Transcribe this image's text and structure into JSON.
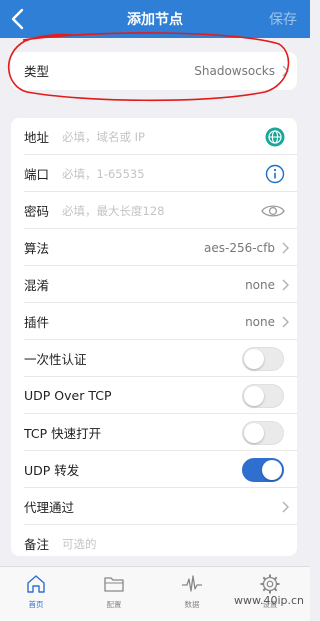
{
  "nav": {
    "title": "添加节点",
    "save_label": "保存"
  },
  "type_row": {
    "label": "类型",
    "value": "Shadowsocks"
  },
  "fields": {
    "address": {
      "label": "地址",
      "placeholder": "必填，域名或 IP"
    },
    "port": {
      "label": "端口",
      "placeholder": "必填，1-65535"
    },
    "password": {
      "label": "密码",
      "placeholder": "必填，最大长度128"
    },
    "cipher": {
      "label": "算法",
      "value": "aes-256-cfb"
    },
    "obfs": {
      "label": "混淆",
      "value": "none"
    },
    "plugin": {
      "label": "插件",
      "value": "none"
    },
    "ota": {
      "label": "一次性认证",
      "enabled": false
    },
    "udp_over_tcp": {
      "label": "UDP Over TCP",
      "enabled": false
    },
    "tcp_fast_open": {
      "label": "TCP 快速打开",
      "enabled": false
    },
    "udp_relay": {
      "label": "UDP 转发",
      "enabled": true
    },
    "proxy_via": {
      "label": "代理通过"
    },
    "remark": {
      "label": "备注",
      "placeholder": "可选的"
    }
  },
  "tabs": [
    {
      "label": "首页",
      "icon": "home-icon",
      "active": true
    },
    {
      "label": "配置",
      "icon": "folder-icon",
      "active": false
    },
    {
      "label": "数据",
      "icon": "pulse-icon",
      "active": false
    },
    {
      "label": "设置",
      "icon": "gear-icon",
      "active": false
    }
  ],
  "watermark": "www.40ip.cn",
  "colors": {
    "nav_bar": "#2f7fd6",
    "accent": "#2f6fcf",
    "annotation": "#e21b1b",
    "info_icon": "#1b6fc4",
    "globe_icon": "#1aa79a"
  }
}
